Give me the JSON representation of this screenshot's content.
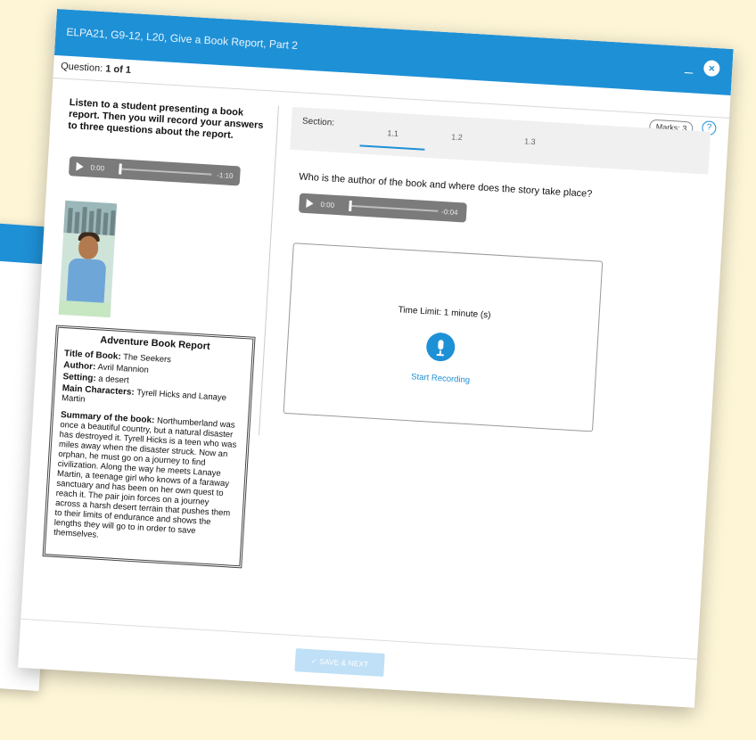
{
  "window": {
    "title": "ELPA21, G9-12, L20, Give a Book Report, Part 2",
    "minimize": "_",
    "close": "×"
  },
  "question_bar": {
    "label": "Question:",
    "value": "1 of 1"
  },
  "marks": "Marks: 3",
  "help": "?",
  "instructions": "Listen to a student presenting a book report. Then you will record your answers to three questions about the report.",
  "main_audio": {
    "elapsed": "0:00",
    "remaining": "-1:10"
  },
  "report": {
    "heading": "Adventure Book Report",
    "title_label": "Title of Book:",
    "title_value": "The Seekers",
    "author_label": "Author:",
    "author_value": "Avril Mannion",
    "setting_label": "Setting:",
    "setting_value": "a desert",
    "characters_label": "Main Characters:",
    "characters_value": "Tyrell Hicks and Lanaye Martin",
    "summary_label": "Summary of the book:",
    "summary_value": "Northumberland was once a beautiful country, but a natural disaster has destroyed it. Tyrell Hicks is a teen who was miles away when the disaster struck. Now an orphan, he must go on a journey to find civilization. Along the way he meets Lanaye Martin, a teenage girl who knows of a faraway sanctuary and has been on her own quest to reach it. The pair join forces on a journey across a harsh desert terrain that pushes them to their limits of endurance and shows the lengths they will go to in order to save themselves."
  },
  "section": {
    "label": "Section:",
    "tabs": [
      "1.1",
      "1.2",
      "1.3"
    ],
    "active": "1.1"
  },
  "question": "Who is the author of the book and where does the story take place?",
  "question_audio": {
    "elapsed": "0:00",
    "remaining": "-0:04"
  },
  "recorder": {
    "time_limit": "Time Limit: 1 minute (s)",
    "start_label": "Start Recording"
  },
  "footer": {
    "save_label": "✓  SAVE & NEXT"
  },
  "colors": {
    "accent": "#1e90d6",
    "background": "#fdf5d6",
    "save_disabled": "#bfe0f6"
  }
}
